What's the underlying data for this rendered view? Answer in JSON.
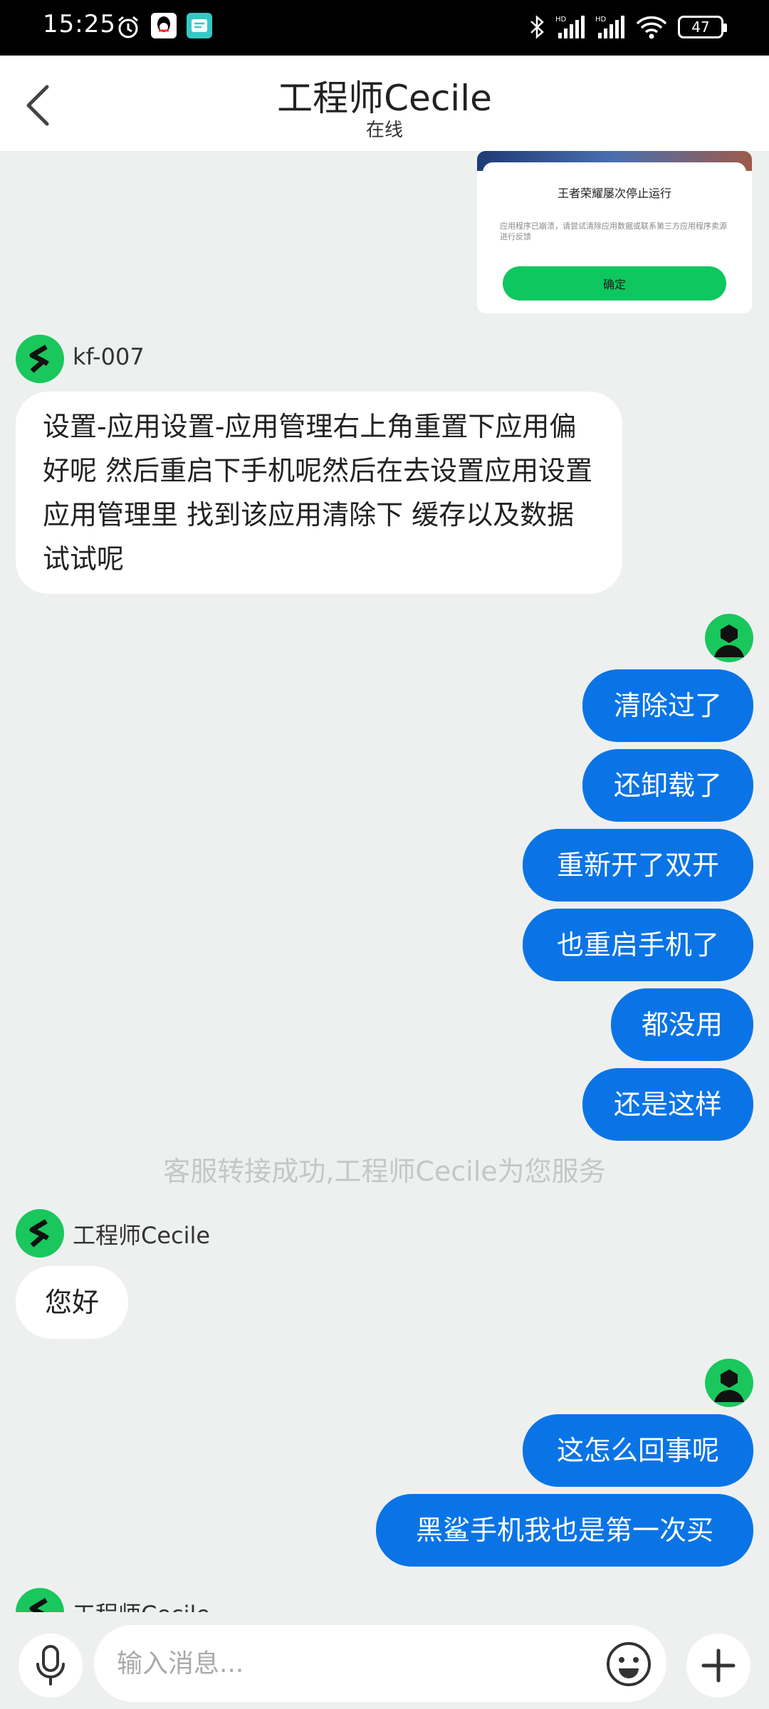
{
  "status_bar": {
    "time": "15:25",
    "battery": "47",
    "icons": [
      "alarm-icon",
      "qq-icon",
      "message-app-icon",
      "bluetooth-icon",
      "hd-signal-icon",
      "hd-signal-icon",
      "wifi-icon",
      "battery-icon"
    ]
  },
  "header": {
    "title": "工程师Cecile",
    "subtitle": "在线",
    "back_icon": "chevron-left-icon"
  },
  "image_message": {
    "dialog_title": "王者荣耀屡次停止运行",
    "dialog_body": "应用程序已崩溃，请尝试清除应用数据或联系第三方应用程序卖源进行反馈",
    "dialog_button": "确定"
  },
  "messages": {
    "m1_sender": "kf-007",
    "m1_text": "设置-应用设置-应用管理右上角重置下应用偏好呢 然后重启下手机呢然后在去设置应用设置 应用管理里 找到该应用清除下 缓存以及数据试试呢",
    "u1": "清除过了",
    "u2": "还卸载了",
    "u3": "重新开了双开",
    "u4": "也重启手机了",
    "u5": "都没用",
    "u6": "还是这样",
    "system": "客服转接成功,工程师Cecile为您服务",
    "m2_sender": "工程师Cecile",
    "m2_text": "您好",
    "u7": "这怎么回事呢",
    "u8": "黑鲨手机我也是第一次买",
    "m3_sender": "工程师Cecile"
  },
  "input_bar": {
    "placeholder": "输入消息..."
  },
  "colors": {
    "accent_green": "#19c75c",
    "outgoing_bubble": "#0a74e6",
    "background": "#eef0f0"
  }
}
